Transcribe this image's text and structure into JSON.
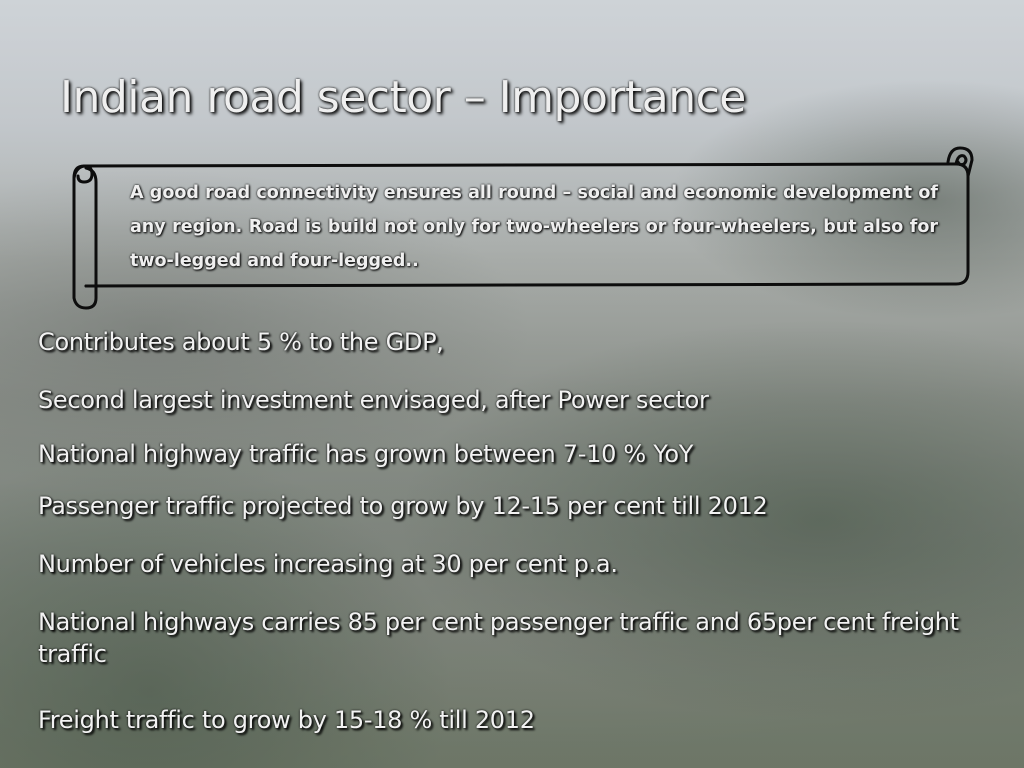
{
  "slide": {
    "title": "Indian road sector – Importance",
    "callout": {
      "text": "A good road connectivity ensures all round – social and economic development of any region. Road is build not only for two-wheelers or four-wheelers, but also for two-legged and four-legged..",
      "shape_icon": "horizontal-scroll-banner"
    },
    "bullets": [
      "Contributes about 5 % to the GDP,",
      "Second largest investment envisaged, after Power sector",
      "National highway traffic has grown between 7-10 % YoY",
      "Passenger traffic projected to grow by 12-15 per cent till 2012",
      "Number of vehicles increasing at 30 per cent p.a.",
      "National highways carries 85 per cent passenger traffic and 65per cent freight traffic",
      "Freight traffic to grow by 15-18 % till 2012"
    ]
  },
  "colors": {
    "text": "#f2f2f2",
    "text_shadow": "#000000",
    "scroll_outline": "#0d0d0d"
  }
}
